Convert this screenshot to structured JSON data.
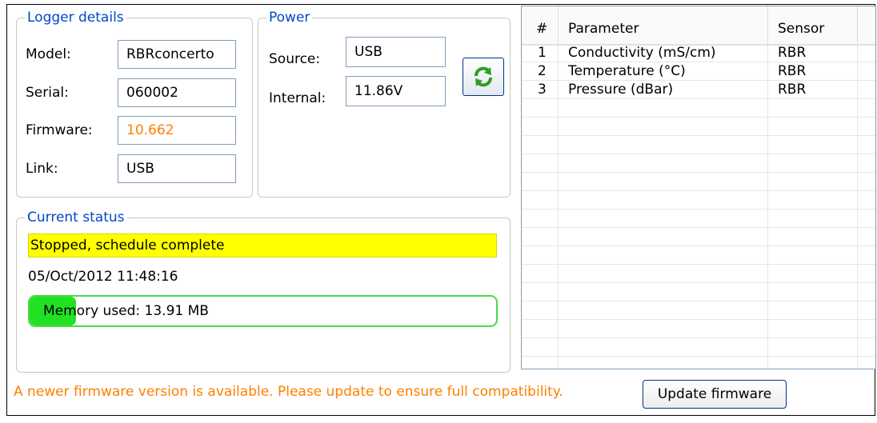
{
  "logger_details": {
    "title": "Logger details",
    "model_label": "Model:",
    "model_value": "RBRconcerto",
    "serial_label": "Serial:",
    "serial_value": "060002",
    "firmware_label": "Firmware:",
    "firmware_value": "10.662",
    "firmware_value_color": "#ff7f00",
    "link_label": "Link:",
    "link_value": "USB"
  },
  "power": {
    "title": "Power",
    "source_label": "Source:",
    "source_value": "USB",
    "internal_label": "Internal:",
    "internal_value": "11.86V",
    "refresh_icon": "refresh-icon"
  },
  "current_status": {
    "title": "Current status",
    "status_text": "Stopped, schedule complete",
    "status_color": "#ffff00",
    "datetime": "05/Oct/2012  11:48:16",
    "memory_label": "Memory used:  13.91 MB",
    "memory_fraction": 0.1,
    "memory_color": "#22e122"
  },
  "parameters_table": {
    "columns": [
      "#",
      "Parameter",
      "Sensor"
    ],
    "rows": [
      {
        "num": "1",
        "parameter": "Conductivity (mS/cm)",
        "sensor": "RBR"
      },
      {
        "num": "2",
        "parameter": "Temperature (°C)",
        "sensor": "RBR"
      },
      {
        "num": "3",
        "parameter": "Pressure (dBar)",
        "sensor": "RBR"
      }
    ]
  },
  "footer": {
    "warning": "A newer firmware version is available. Please update to ensure full compatibility.",
    "warning_color": "#ff7f00",
    "update_button": "Update firmware"
  }
}
